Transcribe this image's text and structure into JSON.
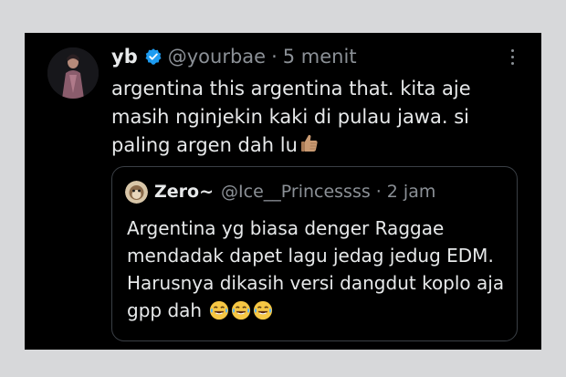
{
  "tweet": {
    "author_name": "yb",
    "author_handle": "@yourbae",
    "separator": "·",
    "time": "5 menit",
    "text": "argentina this argentina that. kita aje masih nginjekin kaki di pulau jawa. si paling argen dah lu",
    "text_emoji": "thumbs-up-icon",
    "verified": true,
    "more_icon": "more-options-icon"
  },
  "quote": {
    "author_name": "Zero~",
    "author_handle": "@Ice__Princessss",
    "separator": "·",
    "time": "2 jam",
    "text": "Argentina yg biasa denger Raggae mendadak dapet lagu jedag jedug EDM. Harusnya dikasih versi dangdut koplo aja gpp dah",
    "text_emoji": [
      "laughing-crying-face-icon",
      "laughing-crying-face-icon",
      "laughing-crying-face-icon"
    ]
  },
  "colors": {
    "background": "#000000",
    "text": "#e7e9ea",
    "secondary_text": "#8b9096",
    "verified_blue": "#1d9bf0",
    "border": "#3a3f45"
  }
}
